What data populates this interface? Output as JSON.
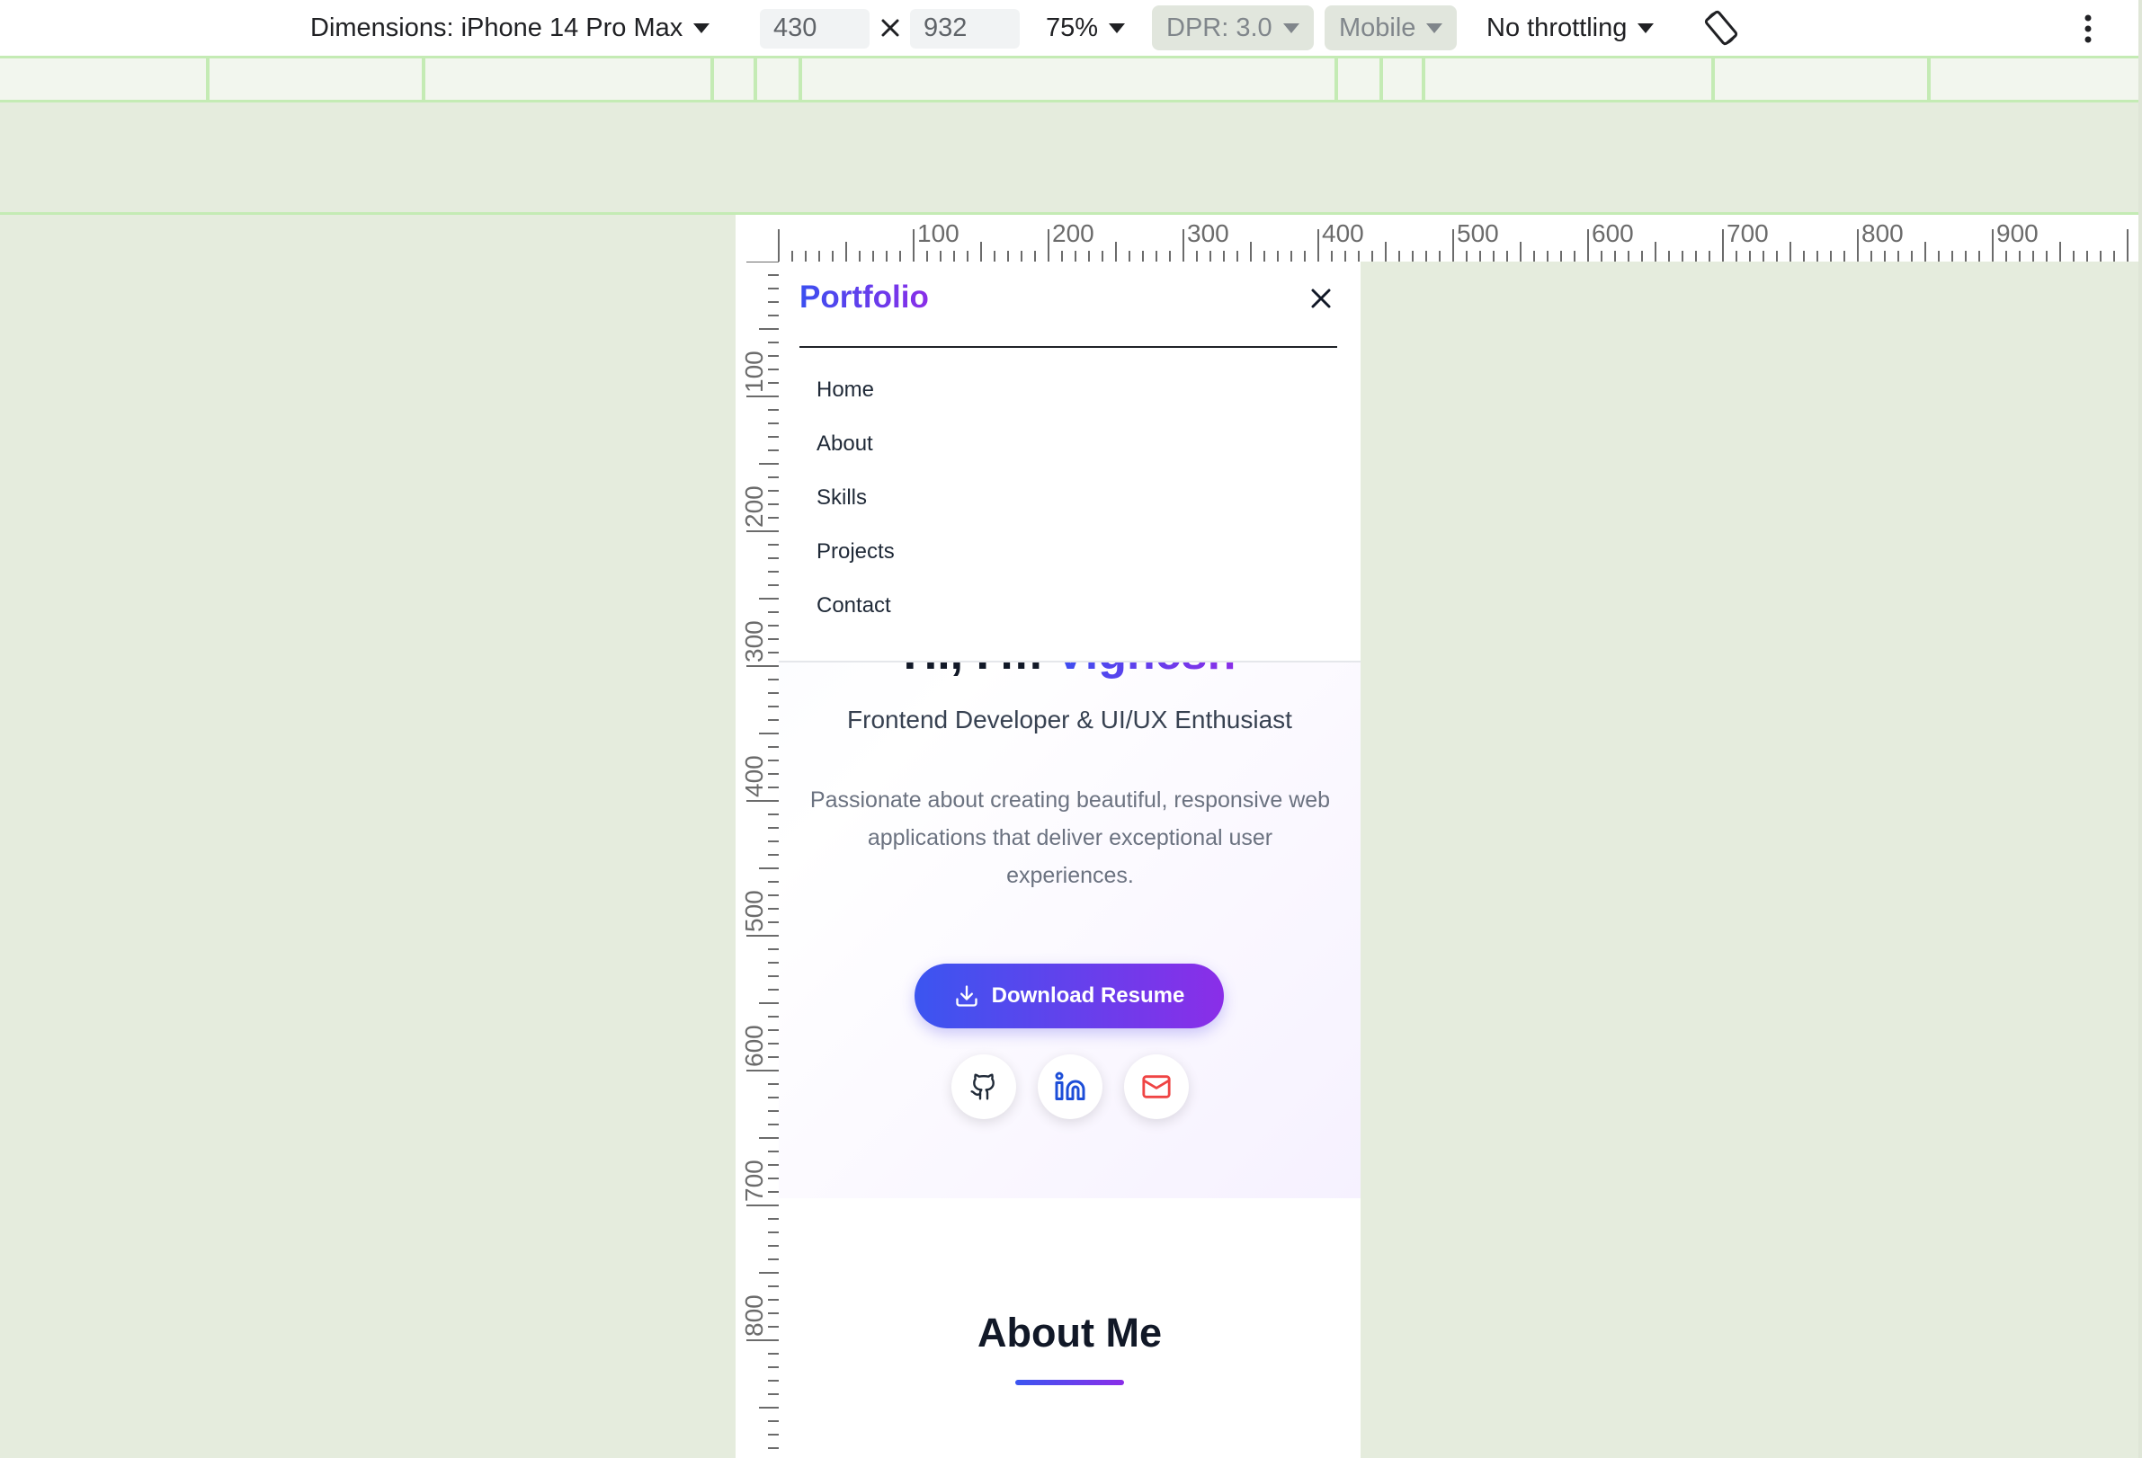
{
  "devtools": {
    "dimensions_label": "Dimensions: iPhone 14 Pro Max",
    "width_value": "430",
    "height_value": "932",
    "zoom": "75%",
    "dpr": "DPR: 3.0",
    "device_type": "Mobile",
    "throttling": "No throttling"
  },
  "ruler": {
    "top_labels": [
      "100",
      "200",
      "300",
      "400",
      "500",
      "600",
      "700",
      "800",
      "900"
    ],
    "left_labels": [
      "100",
      "200",
      "300",
      "400",
      "500",
      "600",
      "700",
      "800"
    ]
  },
  "nav": {
    "logo": "Portfolio",
    "items": [
      {
        "label": "Home"
      },
      {
        "label": "About"
      },
      {
        "label": "Skills"
      },
      {
        "label": "Projects"
      },
      {
        "label": "Contact"
      }
    ]
  },
  "hero": {
    "greeting": "Hi, I'm ",
    "name": "Vignesh",
    "subtitle": "Frontend Developer & UI/UX Enthusiast",
    "description": "Passionate about creating beautiful, responsive web applications that deliver exceptional user experiences.",
    "download_label": "Download Resume",
    "socials": [
      {
        "icon": "github-icon"
      },
      {
        "icon": "linkedin-icon"
      },
      {
        "icon": "mail-icon"
      }
    ]
  },
  "about": {
    "title": "About Me"
  },
  "colors": {
    "accent_start": "#3b4ff0",
    "accent_end": "#8a2ee8",
    "mail_red": "#ef4444",
    "linkedin_blue": "#1d4ed8"
  }
}
